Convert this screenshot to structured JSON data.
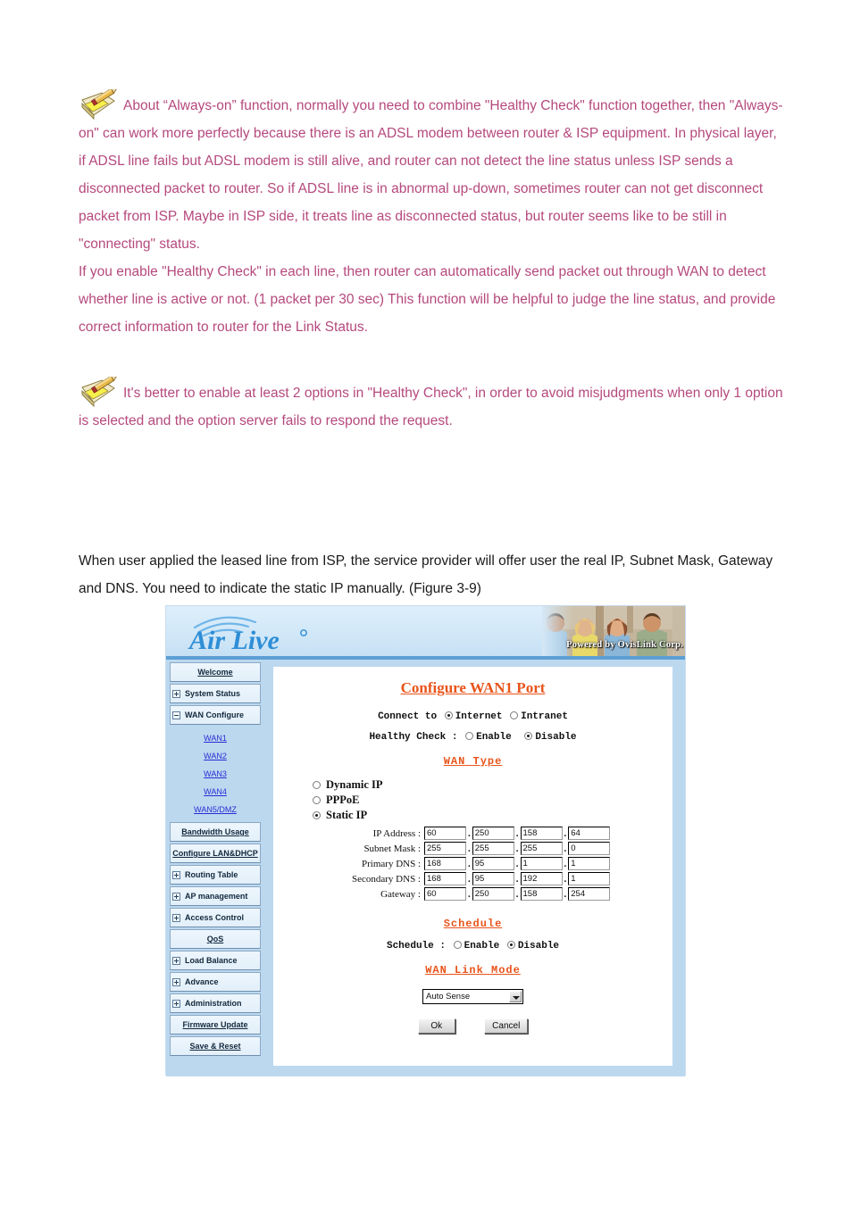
{
  "notes": [
    {
      "icon": "note-pencil-icon",
      "paragraphs": [
        "About “Always-on” function, normally you need to combine \"Healthy Check\" function together, then \"Always-on\" can work more perfectly because there is an ADSL modem between router & ISP equipment. In physical layer, if ADSL line fails but ADSL modem is still alive, and router can not detect the line status unless ISP sends a disconnected packet to router. So if ADSL line is in abnormal up-down, sometimes router can not get disconnect packet from ISP. Maybe in ISP side, it treats line as disconnected status, but router seems like to be still in \"connecting\" status.",
        "If you enable \"Healthy Check\" in each line, then router can automatically send packet out through WAN to detect whether line is active or not. (1 packet per 30 sec) This function will be helpful to judge the line status, and provide correct information to router for the Link Status."
      ]
    },
    {
      "icon": "note-pencil-icon",
      "paragraphs": [
        "It's better to enable at least 2 options in \"Healthy Check\", in order to avoid misjudgments when only 1 option is selected and the option server fails to respond the request."
      ]
    }
  ],
  "body_text": "When user applied the leased line from ISP, the service provider will offer user the real IP, Subnet Mask, Gateway and DNS. You need to indicate the static IP manually. (Figure 3-9)",
  "colors": {
    "note_text": "#b5497d",
    "body_text": "#1a1a1a",
    "accent_orange": "#e8541a",
    "logo_blue": "#2e8ed6",
    "panel_blue": "#bcd8ef",
    "link_blue": "#2b2bd4"
  },
  "router_ui": {
    "header": {
      "logo_text": "Air Live",
      "logo_mark": "wifi-arc-icon",
      "powered_by": "Powered by OvisLink Corp."
    },
    "sidebar": {
      "items": [
        {
          "label": "Welcome",
          "expander": "none",
          "style": "centered"
        },
        {
          "label": "System Status",
          "expander": "plus",
          "style": "left"
        },
        {
          "label": "WAN Configure",
          "expander": "minus",
          "style": "left"
        }
      ],
      "sub_links": [
        "WAN1",
        "WAN2",
        "WAN3",
        "WAN4",
        "WAN5/DMZ"
      ],
      "items_after": [
        {
          "label": "Bandwidth Usage",
          "expander": "none",
          "style": "centered"
        },
        {
          "label": "Configure LAN&DHCP",
          "expander": "none",
          "style": "centered"
        },
        {
          "label": "Routing Table",
          "expander": "plus",
          "style": "left"
        },
        {
          "label": "AP management",
          "expander": "plus",
          "style": "left"
        },
        {
          "label": "Access Control",
          "expander": "plus",
          "style": "left"
        },
        {
          "label": "QoS",
          "expander": "none",
          "style": "centered"
        },
        {
          "label": "Load Balance",
          "expander": "plus",
          "style": "left"
        },
        {
          "label": "Advance",
          "expander": "plus",
          "style": "left"
        },
        {
          "label": "Administration",
          "expander": "plus",
          "style": "left"
        },
        {
          "label": "Firmware Update",
          "expander": "none",
          "style": "centered"
        },
        {
          "label": "Save & Reset",
          "expander": "none",
          "style": "centered"
        }
      ]
    },
    "panel": {
      "title": "Configure WAN1 Port",
      "connect_to": {
        "label": "Connect to",
        "options": [
          "Internet",
          "Intranet"
        ],
        "selected": "Internet"
      },
      "healthy_check": {
        "label": "Healthy Check :",
        "options": [
          "Enable",
          "Disable"
        ],
        "selected": "Disable"
      },
      "wan_type": {
        "heading": "WAN Type",
        "options": [
          "Dynamic IP",
          "PPPoE",
          "Static IP"
        ],
        "selected": "Static IP"
      },
      "static_ip_fields": [
        {
          "label": "IP Address :",
          "octets": [
            "60",
            "250",
            "158",
            "64"
          ]
        },
        {
          "label": "Subnet Mask :",
          "octets": [
            "255",
            "255",
            "255",
            "0"
          ]
        },
        {
          "label": "Primary DNS :",
          "octets": [
            "168",
            "95",
            "1",
            "1"
          ]
        },
        {
          "label": "Secondary DNS :",
          "octets": [
            "168",
            "95",
            "192",
            "1"
          ]
        },
        {
          "label": "Gateway :",
          "octets": [
            "60",
            "250",
            "158",
            "254"
          ]
        }
      ],
      "schedule": {
        "heading": "Schedule",
        "label": "Schedule :",
        "options": [
          "Enable",
          "Disable"
        ],
        "selected": "Disable"
      },
      "wan_link_mode": {
        "heading": "WAN Link Mode",
        "selected": "Auto Sense"
      },
      "buttons": {
        "ok": "Ok",
        "cancel": "Cancel"
      }
    }
  }
}
